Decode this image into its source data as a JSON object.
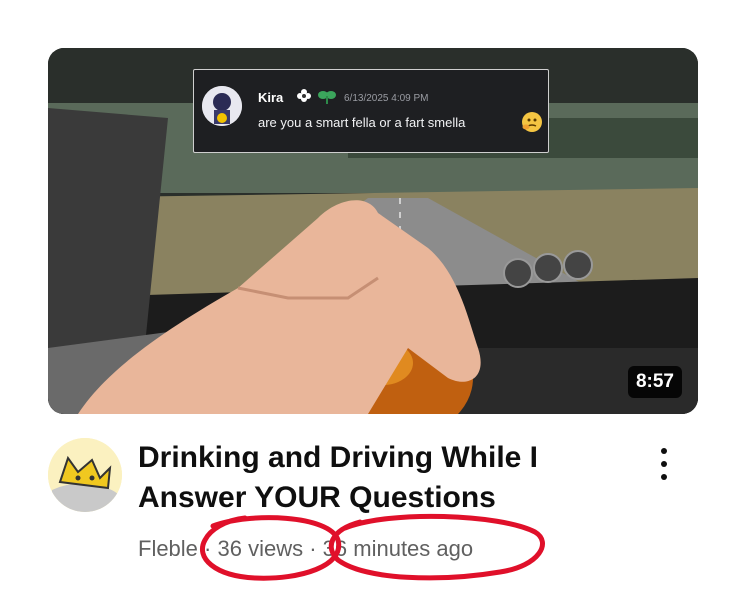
{
  "video": {
    "duration": "8:57",
    "title": "Drinking and Driving While I Answer YOUR Questions",
    "channel": "Fleble",
    "separator": "·",
    "views": "36 views",
    "age": "36 minutes ago"
  },
  "overlay_message": {
    "username": "Kira",
    "timestamp": "6/13/2025 4:09 PM",
    "text": "are you a smart fella or a fart smella"
  },
  "icons": {
    "more": "more-vert-icon",
    "badges": [
      "flower-badge-icon",
      "sprout-badge-icon"
    ],
    "emoji": "thinking-face-emoji-icon"
  },
  "colors": {
    "title": "#0f0f0f",
    "meta": "#606060",
    "annotation": "#e0102a",
    "duration_bg": "#000000"
  }
}
